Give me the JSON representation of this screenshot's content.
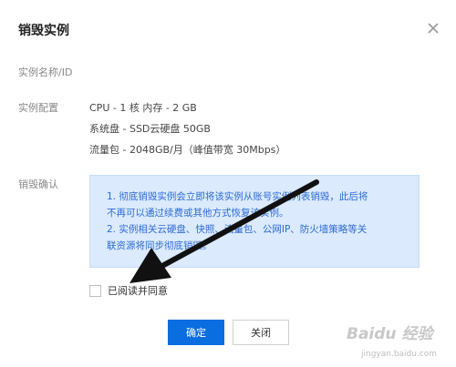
{
  "dialog": {
    "title": "销毁实例",
    "close_icon": "close-icon"
  },
  "fields": {
    "instance_name_label": "实例名称/ID",
    "config_label": "实例配置",
    "config_lines": [
      "CPU - 1 核 内存 - 2 GB",
      "系统盘 - SSD云硬盘 50GB",
      "流量包 - 2048GB/月（峰值带宽 30Mbps）"
    ],
    "confirm_label": "销毁确认"
  },
  "notice": {
    "lines": [
      "1. 彻底销毁实例会立即将该实例从账号实例列表销毁，此后将",
      "不再可以通过续费或其他方式恢复该实例。",
      "2. 实例相关云硬盘、快照、流量包、公网IP、防火墙策略等关",
      "联资源将同步彻底销毁。"
    ]
  },
  "agree": {
    "label": "已阅读并同意",
    "checked": false
  },
  "buttons": {
    "confirm": "确定",
    "close": "关闭"
  },
  "watermark": {
    "logo": "Baidu 经验",
    "url": "jingyan.baidu.com"
  },
  "colors": {
    "primary": "#0a6de0",
    "notice_bg": "#dbeafc",
    "notice_text": "#2e6bd6",
    "arrow": "#111111"
  }
}
